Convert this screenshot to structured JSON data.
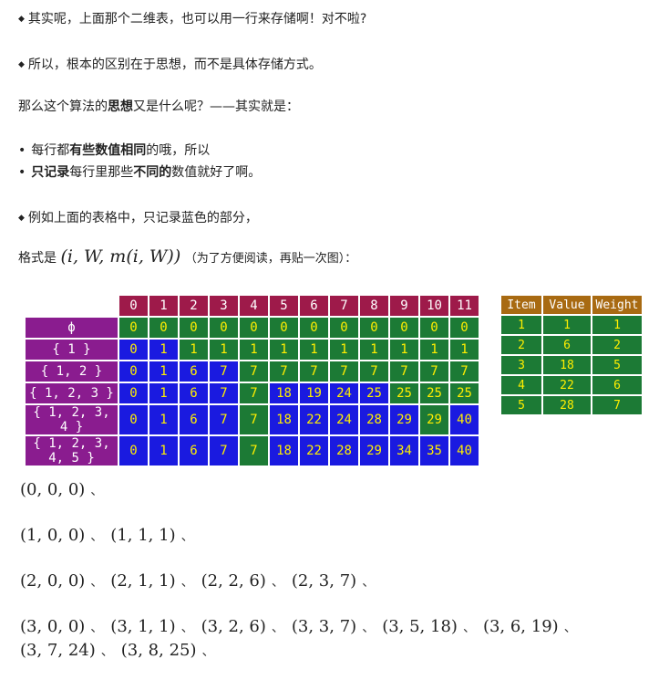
{
  "text": {
    "p1": "其实呢，上面那个二维表，也可以用一行来存储啊！对不啦?",
    "p2": "所以，根本的区别在于思想，而不是具体存储方式。",
    "p3_pre": "那么这个算法的",
    "p3_bold": "思想",
    "p3_post": "又是什么呢？——其实就是：",
    "li1_pre": "每行都",
    "li1_bold": "有些数值相同",
    "li1_post": "的哦，所以",
    "li2_bold1": "只记录",
    "li2_mid": "每行里那些",
    "li2_bold2": "不同的",
    "li2_post": "数值就好了啊。",
    "p4": "例如上面的表格中，只记录蓝色的部分，",
    "p5_pre": "格式是",
    "p5_math": "(i, W, m(i, W))",
    "p5_post": "（为了方便阅读，再贴一次图）："
  },
  "dp_table": {
    "columns": [
      "0",
      "1",
      "2",
      "3",
      "4",
      "5",
      "6",
      "7",
      "8",
      "9",
      "10",
      "11"
    ],
    "rows": [
      {
        "label": "ϕ",
        "values": [
          "0",
          "0",
          "0",
          "0",
          "0",
          "0",
          "0",
          "0",
          "0",
          "0",
          "0",
          "0"
        ],
        "colors": [
          "g",
          "g",
          "g",
          "g",
          "g",
          "g",
          "g",
          "g",
          "g",
          "g",
          "g",
          "g"
        ]
      },
      {
        "label": "{ 1 }",
        "values": [
          "0",
          "1",
          "1",
          "1",
          "1",
          "1",
          "1",
          "1",
          "1",
          "1",
          "1",
          "1"
        ],
        "colors": [
          "b",
          "b",
          "g",
          "g",
          "g",
          "g",
          "g",
          "g",
          "g",
          "g",
          "g",
          "g"
        ]
      },
      {
        "label": "{ 1, 2 }",
        "values": [
          "0",
          "1",
          "6",
          "7",
          "7",
          "7",
          "7",
          "7",
          "7",
          "7",
          "7",
          "7"
        ],
        "colors": [
          "b",
          "b",
          "b",
          "b",
          "g",
          "g",
          "g",
          "g",
          "g",
          "g",
          "g",
          "g"
        ]
      },
      {
        "label": "{ 1, 2, 3 }",
        "values": [
          "0",
          "1",
          "6",
          "7",
          "7",
          "18",
          "19",
          "24",
          "25",
          "25",
          "25",
          "25"
        ],
        "colors": [
          "b",
          "b",
          "b",
          "b",
          "g",
          "b",
          "b",
          "b",
          "b",
          "g",
          "g",
          "g"
        ]
      },
      {
        "label": "{ 1, 2, 3, 4 }",
        "values": [
          "0",
          "1",
          "6",
          "7",
          "7",
          "18",
          "22",
          "24",
          "28",
          "29",
          "29",
          "40"
        ],
        "colors": [
          "b",
          "b",
          "b",
          "b",
          "g",
          "b",
          "b",
          "b",
          "b",
          "b",
          "g",
          "b"
        ]
      },
      {
        "label": "{ 1, 2, 3, 4, 5 }",
        "values": [
          "0",
          "1",
          "6",
          "7",
          "7",
          "18",
          "22",
          "28",
          "29",
          "34",
          "35",
          "40"
        ],
        "colors": [
          "b",
          "b",
          "b",
          "b",
          "g",
          "b",
          "b",
          "b",
          "b",
          "b",
          "b",
          "b"
        ]
      }
    ]
  },
  "items_table": {
    "headers": [
      "Item",
      "Value",
      "Weight"
    ],
    "rows": [
      [
        "1",
        "1",
        "1"
      ],
      [
        "2",
        "6",
        "2"
      ],
      [
        "3",
        "18",
        "5"
      ],
      [
        "4",
        "22",
        "6"
      ],
      [
        "5",
        "28",
        "7"
      ]
    ]
  },
  "sequences": [
    [
      "(0, 0, 0)"
    ],
    [
      "(1, 0, 0)",
      "(1, 1, 1)"
    ],
    [
      "(2, 0, 0)",
      "(2, 1, 1)",
      "(2, 2, 6)",
      "(2, 3, 7)"
    ],
    [
      "(3, 0, 0)",
      "(3, 1, 1)",
      "(3, 2, 6)",
      "(3, 3, 7)",
      "(3, 5, 18)",
      "(3, 6, 19)"
    ],
    [
      "(3, 7, 24)",
      "(3, 8, 25)"
    ]
  ],
  "separator": "、",
  "colors": {
    "header": "#9e1a4a",
    "row_header": "#8a1c8f",
    "green_cell": "#1c7a35",
    "blue_cell": "#1a1ae0",
    "cell_text": "#ffee00",
    "item_header": "#a86a12"
  }
}
